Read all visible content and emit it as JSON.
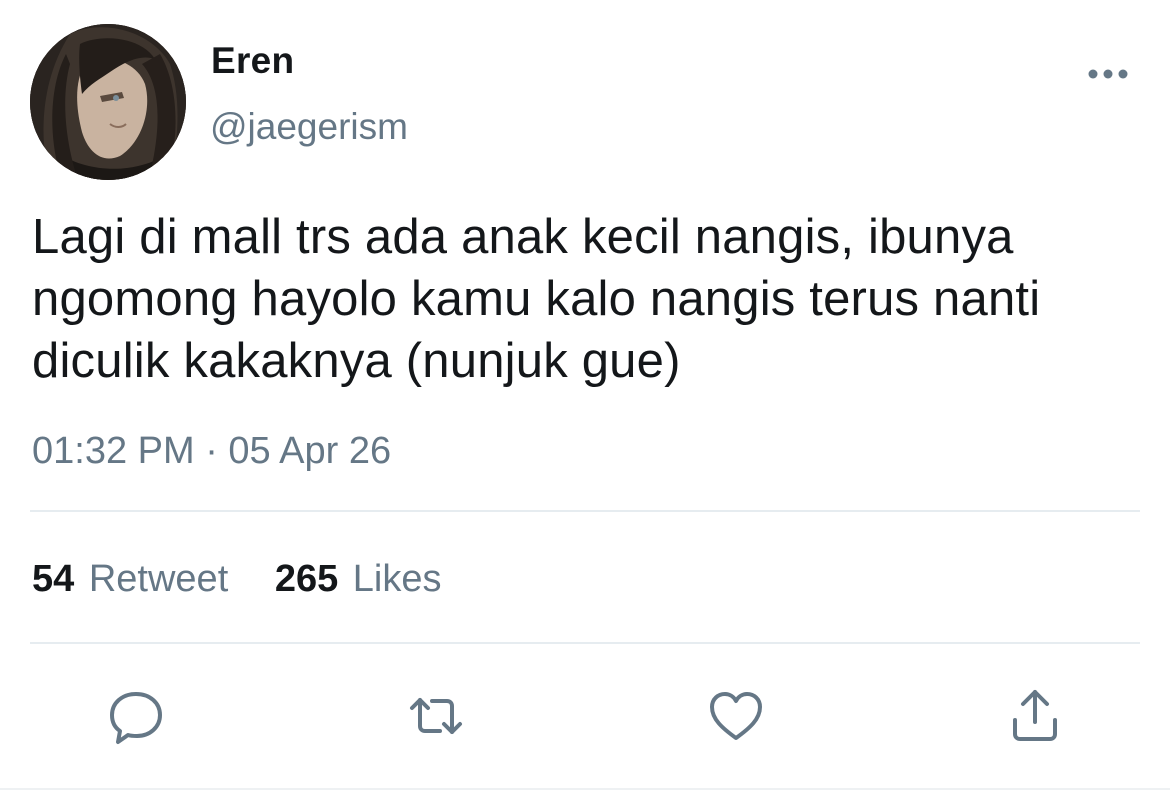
{
  "user": {
    "display_name": "Eren",
    "handle": "@jaegerism",
    "avatar": "anime-character-avatar"
  },
  "tweet": {
    "text": "Lagi di mall trs ada anak kecil nangis, ibunya ngomong hayolo kamu kalo nangis terus nanti diculik kakaknya (nunjuk gue)",
    "timestamp": "01:32 PM · 05 Apr 26"
  },
  "stats": {
    "retweets_count": "54",
    "retweets_label": "Retweet",
    "likes_count": "265",
    "likes_label": "Likes"
  },
  "actions": {
    "icons": [
      "reply-icon",
      "retweet-icon",
      "like-icon",
      "share-icon"
    ]
  },
  "colors": {
    "text_primary": "#14171a",
    "text_secondary": "#657786",
    "icon": "#657786",
    "divider": "#e6ecf0"
  }
}
